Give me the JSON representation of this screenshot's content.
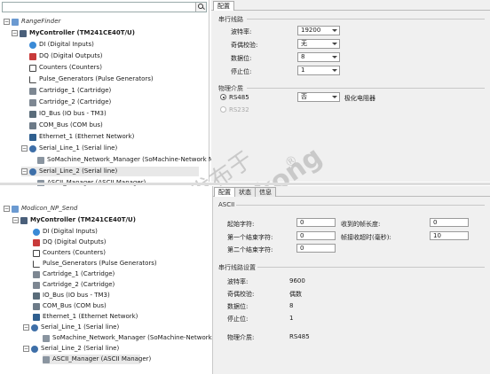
{
  "top": {
    "search": {
      "placeholder": ""
    },
    "tree": [
      {
        "label": "RangeFinder",
        "style": "italic"
      },
      {
        "label": "MyController (TM241CE40T/U)",
        "style": "bold"
      },
      {
        "label": "DI (Digital Inputs)"
      },
      {
        "label": "DQ (Digital Outputs)"
      },
      {
        "label": "Counters (Counters)"
      },
      {
        "label": "Pulse_Generators (Pulse Generators)"
      },
      {
        "label": "Cartridge_1 (Cartridge)"
      },
      {
        "label": "Cartridge_2 (Cartridge)"
      },
      {
        "label": "IO_Bus (IO bus - TM3)"
      },
      {
        "label": "COM_Bus (COM bus)"
      },
      {
        "label": "Ethernet_1 (Ethernet Network)"
      },
      {
        "label": "Serial_Line_1 (Serial line)"
      },
      {
        "label": "SoMachine_Network_Manager (SoMachine-Network Manager)"
      },
      {
        "label": "Serial_Line_2 (Serial line)"
      },
      {
        "label": "ASCII_Manager (ASCII Manager)"
      }
    ],
    "config": {
      "tab": "配置",
      "serial_section": "串行线路",
      "fields": [
        {
          "label": "波特率:",
          "value": "19200"
        },
        {
          "label": "奇偶校验:",
          "value": "无"
        },
        {
          "label": "数据位:",
          "value": "8"
        },
        {
          "label": "停止位:",
          "value": "1"
        }
      ],
      "physical_section": "物理介质",
      "rs485_label": "RS485",
      "rs485_select": "否",
      "polarization_label": "极化电阻器",
      "rs232_label": "RS232"
    }
  },
  "watermark": {
    "line1": "发布于",
    "line2": "gongkong",
    "reg": "®"
  },
  "bottom": {
    "tree": [
      {
        "label": "Modicon_NP_Send",
        "style": "italic"
      },
      {
        "label": "MyController (TM241CE40T/U)",
        "style": "bold"
      },
      {
        "label": "DI (Digital Inputs)"
      },
      {
        "label": "DQ (Digital Outputs)"
      },
      {
        "label": "Counters (Counters)"
      },
      {
        "label": "Pulse_Generators (Pulse Generators)"
      },
      {
        "label": "Cartridge_1 (Cartridge)"
      },
      {
        "label": "Cartridge_2 (Cartridge)"
      },
      {
        "label": "IO_Bus (IO bus - TM3)"
      },
      {
        "label": "COM_Bus (COM bus)"
      },
      {
        "label": "Ethernet_1 (Ethernet Network)"
      },
      {
        "label": "Serial_Line_1 (Serial line)"
      },
      {
        "label": "SoMachine_Network_Manager (SoMachine-Network Manager)"
      },
      {
        "label": "Serial_Line_2 (Serial line)"
      },
      {
        "label": "ASCII_Manager (ASCII Manager)"
      }
    ],
    "config": {
      "tabs": [
        "配置",
        "状态",
        "信息"
      ],
      "ascii_section": "ASCII",
      "start_char_label": "起始字符:",
      "start_char_value": "0",
      "end_char1_label": "第一个结束字符:",
      "end_char1_value": "0",
      "end_char2_label": "第二个结束字符:",
      "end_char2_value": "0",
      "recv_len_label": "收到的帧长度:",
      "recv_len_value": "0",
      "frame_timeout_label": "帧接收超时(毫秒):",
      "frame_timeout_value": "10",
      "serial_section": "串行线路设置",
      "ro_fields": [
        {
          "label": "波特率:",
          "value": "9600"
        },
        {
          "label": "奇偶校验:",
          "value": "偶数"
        },
        {
          "label": "数据位:",
          "value": "8"
        },
        {
          "label": "停止位:",
          "value": "1"
        },
        {
          "label": "物理介质:",
          "value": "RS485"
        }
      ]
    }
  }
}
